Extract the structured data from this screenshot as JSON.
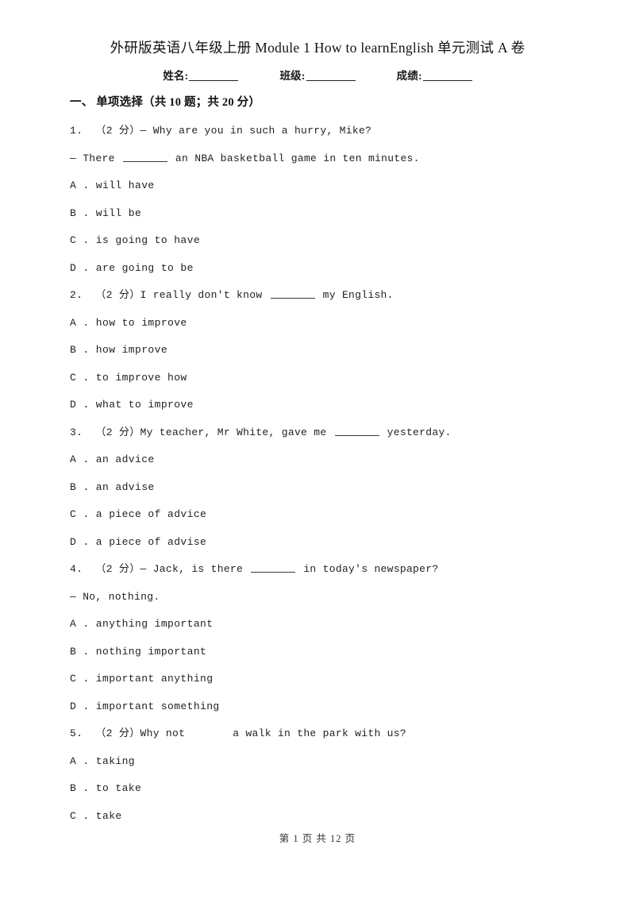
{
  "document": {
    "title": "外研版英语八年级上册 Module 1 How to learnEnglish 单元测试 A 卷",
    "identity_fields": [
      {
        "label": "姓名:"
      },
      {
        "label": "班级:"
      },
      {
        "label": "成绩:"
      }
    ],
    "footer": "第 1 页 共 12 页"
  },
  "section": {
    "heading": "一、 单项选择（共 10 题；共 20 分）"
  },
  "questions": [
    {
      "number": "1.",
      "points": "（2 分）",
      "stem_prefix": "1.  （2 分）— Why are you in such a hurry, Mike?",
      "stem_line2_before": "— There ",
      "blank_type": "underline",
      "stem_line2_after": " an NBA basketball game in ten minutes.",
      "options": [
        "A . will have",
        "B . will be",
        "C . is going to have",
        "D . are going to be"
      ]
    },
    {
      "number": "2.",
      "points": "（2 分）",
      "stem_before": "2.  （2 分）I really don't know ",
      "blank_type": "underline",
      "stem_after": " my English.",
      "options": [
        "A . how to improve",
        "B . how improve",
        "C . to improve how",
        "D . what to improve"
      ]
    },
    {
      "number": "3.",
      "points": "（2 分）",
      "stem_before": "3.  （2 分）My teacher, Mr White, gave me ",
      "blank_type": "underline",
      "stem_after": " yesterday.",
      "options": [
        "A . an advice",
        "B . an advise",
        "C . a piece of advice",
        "D . a piece of advise"
      ]
    },
    {
      "number": "4.",
      "points": "（2 分）",
      "stem_before": "4.  （2 分）— Jack, is there ",
      "blank_type": "underline",
      "stem_after": " in today's newspaper?",
      "stem_line2": "— No, nothing.",
      "options": [
        "A . anything important",
        "B . nothing important",
        "C . important anything",
        "D . important something"
      ]
    },
    {
      "number": "5.",
      "points": "（2 分）",
      "stem_before": "5.  （2 分）Why not",
      "blank_type": "gap",
      "stem_after": "a walk in the park with us?",
      "options": [
        "A . taking",
        "B . to take",
        "C . take"
      ]
    }
  ]
}
